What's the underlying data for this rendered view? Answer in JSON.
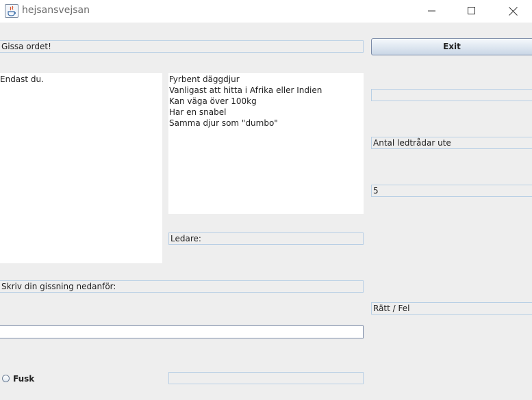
{
  "window": {
    "title": "hejsansvejsan"
  },
  "header_label": "Gissa ordet!",
  "exit_button": "Exit",
  "left_textarea": "Endast du.",
  "clues_textarea": "Fyrbent däggdjur\nVanligast att hitta i Afrika eller Indien\nKan väga över 100kg\nHar en snabel\nSamma djur som \"dumbo\"",
  "status_field_1": "",
  "clues_out_label": "Antal ledtrådar ute",
  "clues_out_count": "5",
  "leader_label": "Ledare:",
  "guess_prompt": "Skriv din gissning nedanför:",
  "result_label": "Rätt / Fel",
  "guess_input": {
    "value": ""
  },
  "cheat": {
    "label": "Fusk",
    "checked": false
  },
  "cheat_field": ""
}
